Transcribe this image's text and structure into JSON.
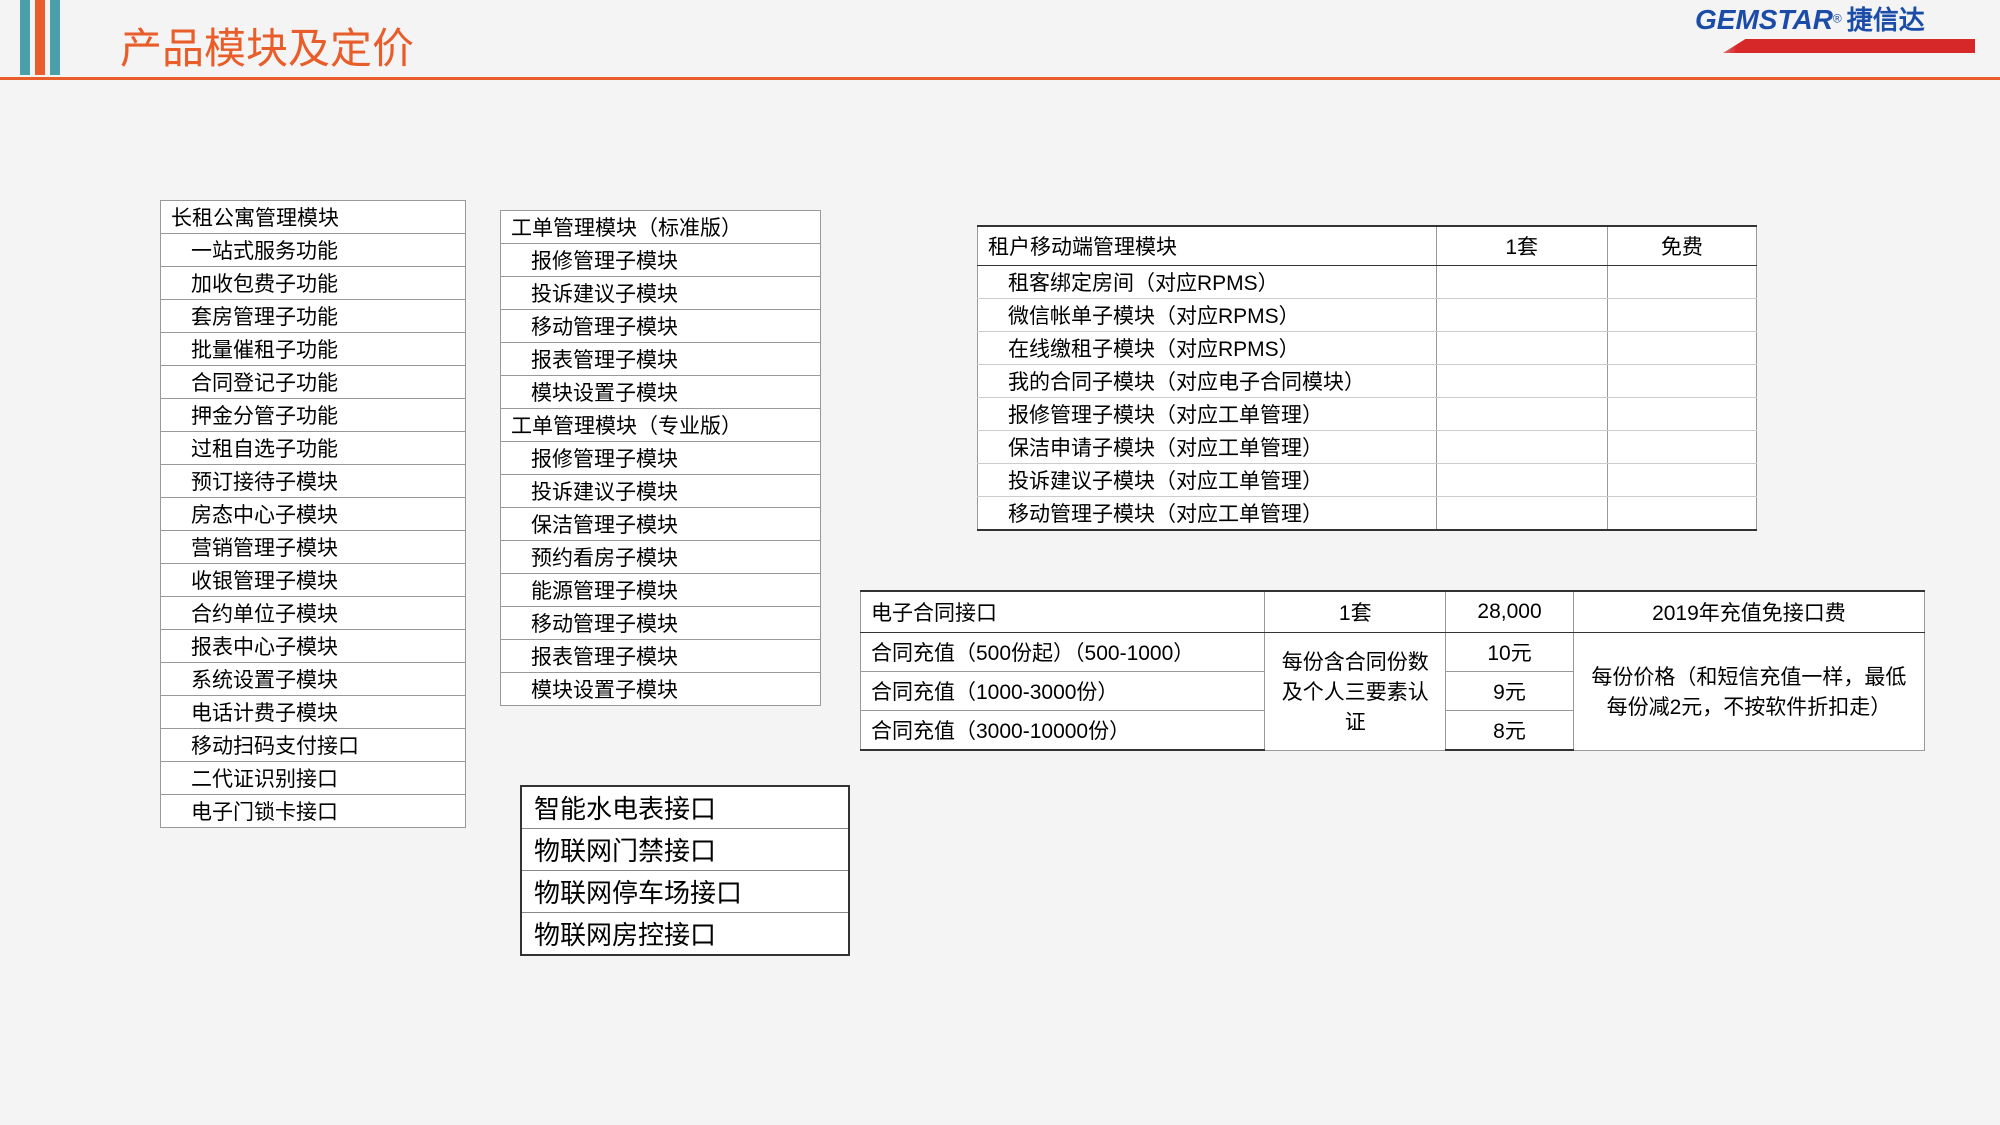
{
  "header": {
    "title": "产品模块及定价",
    "logo_en": "GEMSTAR",
    "logo_reg": "®",
    "logo_cn": "捷信达"
  },
  "table_a": {
    "title": "长租公寓管理模块",
    "items": [
      "一站式服务功能",
      "加收包费子功能",
      "套房管理子功能",
      "批量催租子功能",
      "合同登记子功能",
      "押金分管子功能",
      "过租自选子功能",
      "预订接待子模块",
      "房态中心子模块",
      "营销管理子模块",
      "收银管理子模块",
      "合约单位子模块",
      "报表中心子模块",
      "系统设置子模块",
      "电话计费子模块",
      "移动扫码支付接口",
      "二代证识别接口",
      "电子门锁卡接口"
    ]
  },
  "table_b": {
    "title1": "工单管理模块（标准版）",
    "items1": [
      "报修管理子模块",
      "投诉建议子模块",
      "移动管理子模块",
      "报表管理子模块",
      "模块设置子模块"
    ],
    "title2": "工单管理模块（专业版）",
    "items2": [
      "报修管理子模块",
      "投诉建议子模块",
      "保洁管理子模块",
      "预约看房子模块",
      "能源管理子模块",
      "移动管理子模块",
      "报表管理子模块",
      "模块设置子模块"
    ]
  },
  "table_c": {
    "items": [
      "智能水电表接口",
      "物联网门禁接口",
      "物联网停车场接口",
      "物联网房控接口"
    ]
  },
  "table_d": {
    "header": [
      "租户移动端管理模块",
      "1套",
      "免费"
    ],
    "items": [
      "租客绑定房间（对应RPMS）",
      "微信帐单子模块（对应RPMS）",
      "在线缴租子模块（对应RPMS）",
      "我的合同子模块（对应电子合同模块）",
      "报修管理子模块（对应工单管理）",
      "保洁申请子模块（对应工单管理）",
      "投诉建议子模块（对应工单管理）",
      "移动管理子模块（对应工单管理）"
    ]
  },
  "table_e": {
    "header": [
      "电子合同接口",
      "1套",
      "28,000",
      "2019年充值免接口费"
    ],
    "rows": [
      {
        "label": "合同充值（500份起）（500-1000）",
        "price": "10元"
      },
      {
        "label": "合同充值（1000-3000份）",
        "price": "9元"
      },
      {
        "label": "合同充值（3000-10000份）",
        "price": "8元"
      }
    ],
    "unit_note": "每份含合同份数及个人三要素认证",
    "price_note": "每份价格（和短信充值一样，最低每份减2元，不按软件折扣走）"
  }
}
